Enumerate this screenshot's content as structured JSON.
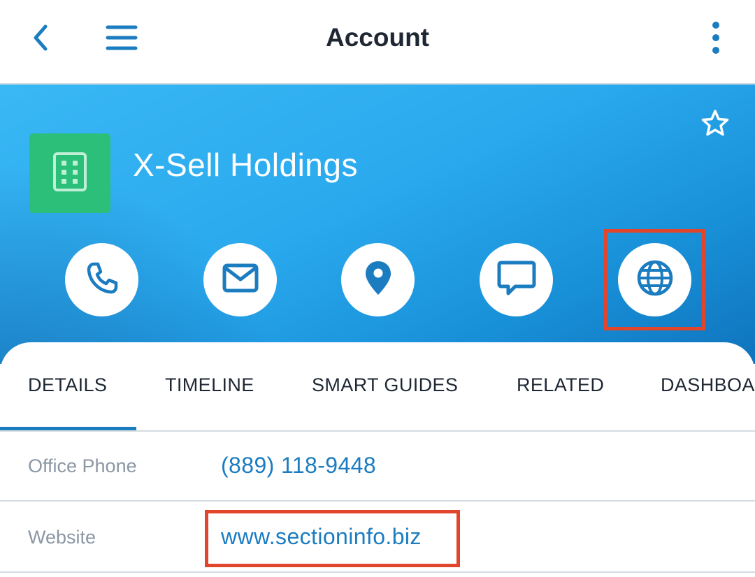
{
  "topbar": {
    "title": "Account",
    "back_icon": "chevron-left-icon",
    "menu_icon": "hamburger-menu-icon",
    "more_icon": "more-vertical-icon"
  },
  "header": {
    "account_name": "X-Sell Holdings",
    "avatar_icon": "building-icon",
    "favorite_icon": "star-outline-icon",
    "actions": [
      {
        "icon": "phone-icon"
      },
      {
        "icon": "email-icon"
      },
      {
        "icon": "map-pin-icon"
      },
      {
        "icon": "message-icon"
      },
      {
        "icon": "globe-icon"
      }
    ]
  },
  "tabs": [
    {
      "label": "DETAILS",
      "active": true
    },
    {
      "label": "TIMELINE",
      "active": false
    },
    {
      "label": "SMART GUIDES",
      "active": false
    },
    {
      "label": "RELATED",
      "active": false
    },
    {
      "label": "DASHBOARD",
      "active": false
    }
  ],
  "details": [
    {
      "label": "Office Phone",
      "value": "(889) 118-9448"
    },
    {
      "label": "Website",
      "value": "www.sectioninfo.biz"
    }
  ],
  "colors": {
    "accent": "#1b7cc0",
    "header_gradient_start": "#39b8f4",
    "header_gradient_end": "#0f73bd",
    "avatar_bg": "#2bbf7a",
    "highlight": "#e1452c"
  }
}
